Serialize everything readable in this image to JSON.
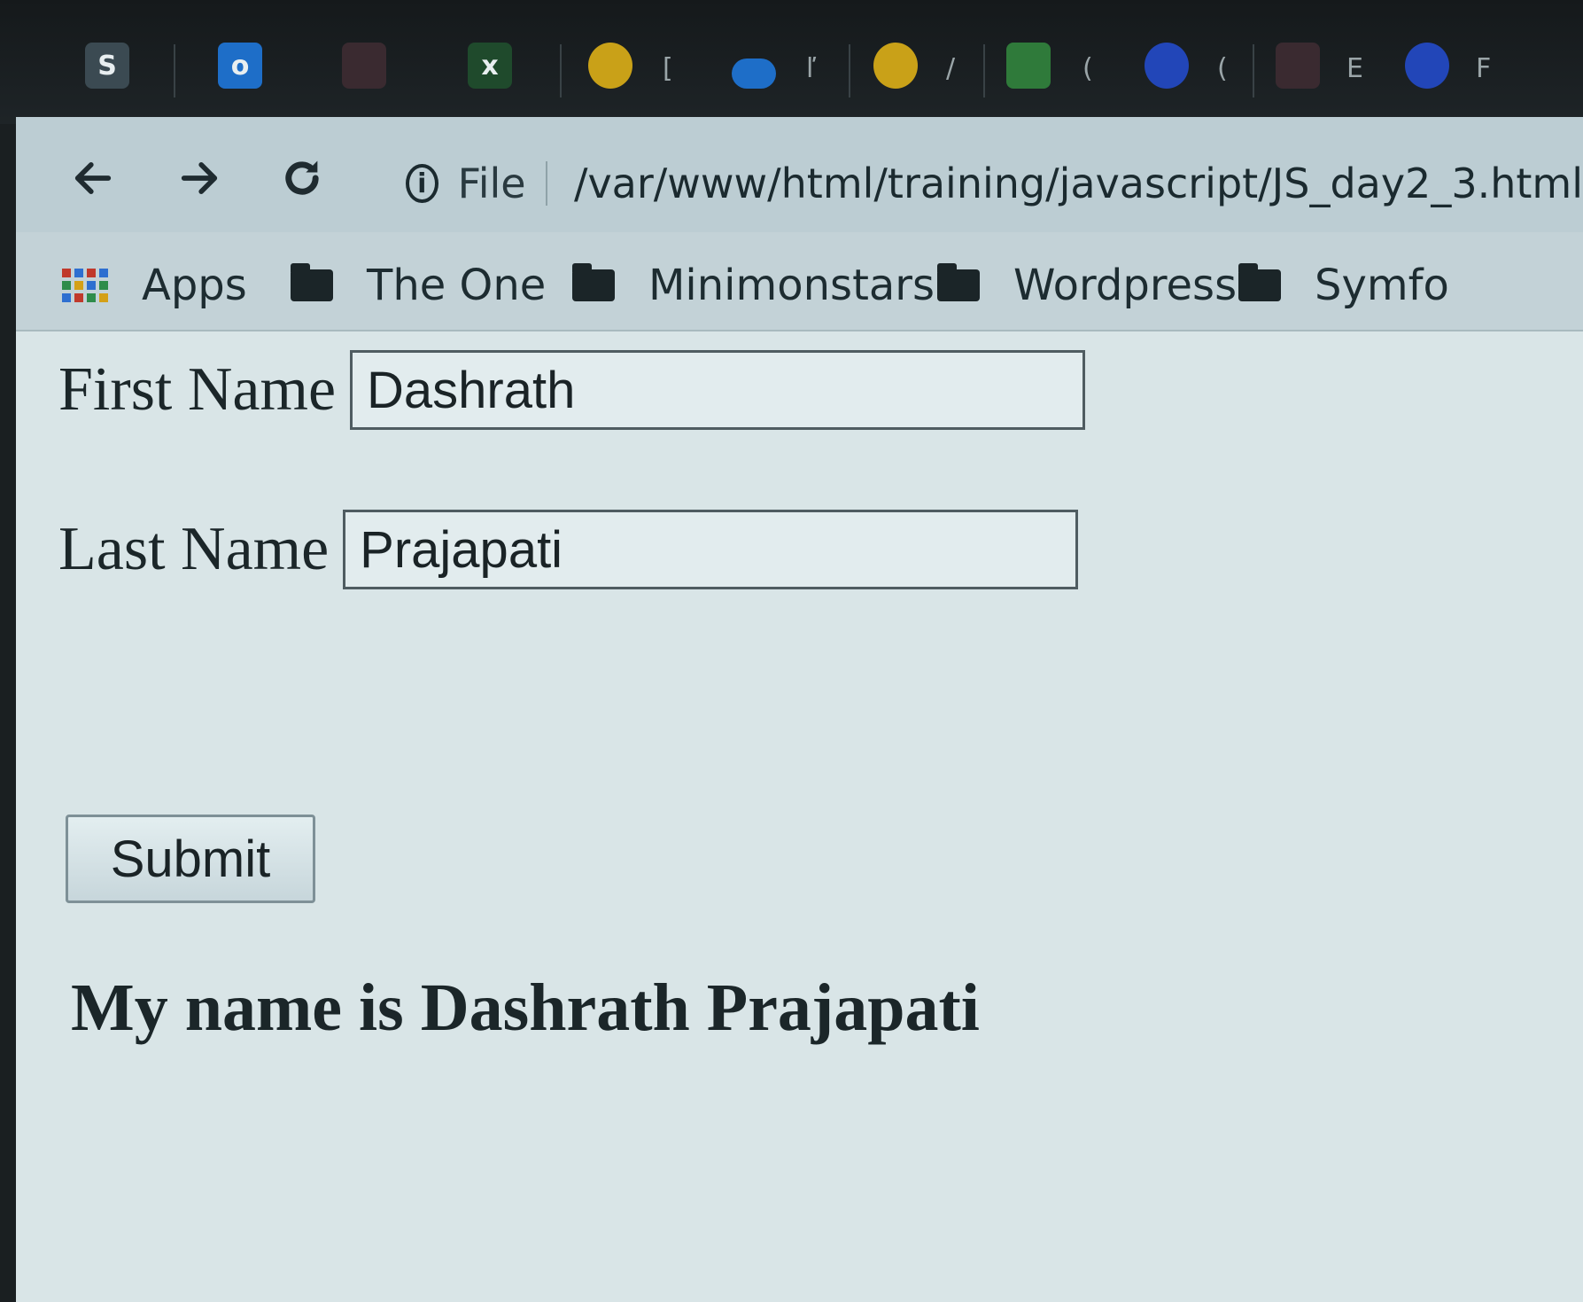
{
  "taskbar": {
    "items": [
      {
        "icon": "sublime-icon",
        "glyph": "S",
        "color": "#3b4a52"
      },
      {
        "icon": "outlook-icon",
        "glyph": "o",
        "color": "#1e6ec8"
      },
      {
        "icon": "app-icon",
        "glyph": "",
        "color": "#3a2a30"
      },
      {
        "icon": "excel-icon",
        "glyph": "x",
        "color": "#1f4a2c"
      },
      {
        "icon": "chrome-icon",
        "glyph": "",
        "color": "#c9a118",
        "label": "["
      },
      {
        "icon": "cloud-icon",
        "glyph": "",
        "color": "#1e6ec8",
        "label": "ľ"
      },
      {
        "icon": "chrome-icon",
        "glyph": "",
        "color": "#c9a118",
        "label": "/"
      },
      {
        "icon": "sheet-icon",
        "glyph": "",
        "color": "#2f7a3a",
        "label": "("
      },
      {
        "icon": "trash-icon",
        "glyph": "",
        "color": "#2246b8",
        "label": "("
      },
      {
        "icon": "app-icon",
        "glyph": "",
        "color": "#3a2a30",
        "label": "E"
      },
      {
        "icon": "trash-icon",
        "glyph": "",
        "color": "#2246b8",
        "label": "F"
      }
    ]
  },
  "browser": {
    "address": {
      "scheme_label": "File",
      "url": "/var/www/html/training/javascript/JS_day2_3.html"
    },
    "bookmarks": [
      {
        "label": "Apps",
        "icon": "apps-grid-icon"
      },
      {
        "label": "The One",
        "icon": "folder-icon"
      },
      {
        "label": "Minimonstars",
        "icon": "folder-icon"
      },
      {
        "label": "Wordpress",
        "icon": "folder-icon"
      },
      {
        "label": "Symfo",
        "icon": "folder-icon"
      }
    ]
  },
  "form": {
    "first_name_label": "First Name",
    "first_name_value": "Dashrath",
    "last_name_label": "Last Name",
    "last_name_value": "Prajapati",
    "submit_label": "Submit"
  },
  "result": {
    "text": "My name is Dashrath Prajapati"
  }
}
